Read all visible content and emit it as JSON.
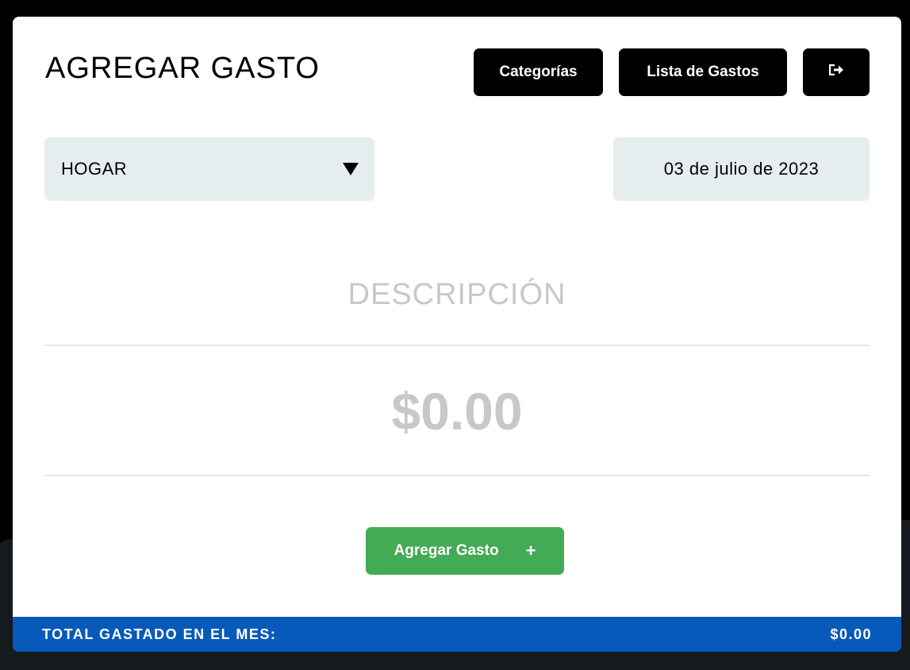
{
  "header": {
    "title": "AGREGAR GASTO",
    "categories_button": "Categorías",
    "expense_list_button": "Lista de Gastos",
    "logout_icon": "logout-icon"
  },
  "form": {
    "category_selected": "HOGAR",
    "date_value": "03 de julio de 2023",
    "description_placeholder": "DESCRIPCIÓN",
    "amount_placeholder": "$0.00",
    "submit_label": "Agregar Gasto",
    "submit_icon": "+"
  },
  "footer": {
    "total_label": "TOTAL GASTADO EN EL MES:",
    "total_value": "$0.00"
  },
  "colors": {
    "background": "#000000",
    "card": "#ffffff",
    "input_bg": "#e6edef",
    "primary_button": "#000000",
    "submit_button": "#43aa55",
    "footer_bar": "#075ab9",
    "placeholder_text": "#c8c8c8"
  }
}
